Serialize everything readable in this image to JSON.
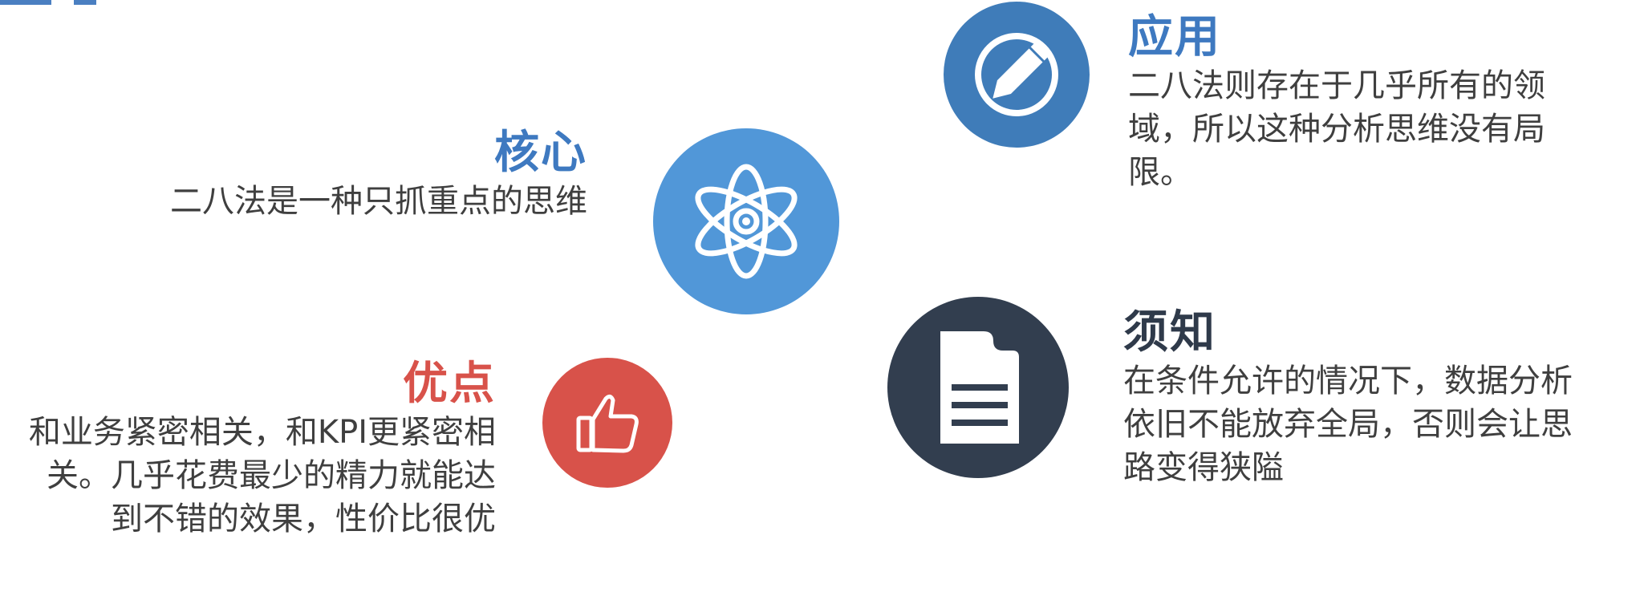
{
  "colors": {
    "core": "#5197d8",
    "application": "#3f7cb9",
    "advantage": "#d8524a",
    "notice": "#323e4f",
    "core_heading": "#3e79c0",
    "application_heading": "#3e79c0",
    "advantage_heading": "#d8524a",
    "notice_heading": "#2f3a4a"
  },
  "core": {
    "icon": "atom-icon",
    "title": "核心",
    "text": "二八法是一种只抓重点的思维"
  },
  "application": {
    "icon": "edit-pencil-icon",
    "title": "应用",
    "text": "二八法则存在于几乎所有的领域，所以这种分析思维没有局限。"
  },
  "advantage": {
    "icon": "thumbs-up-icon",
    "title": "优点",
    "text": "和业务紧密相关，和KPI更紧密相关。几乎花费最少的精力就能达到不错的效果，性价比很优"
  },
  "notice": {
    "icon": "document-icon",
    "title": "须知",
    "text": "在条件允许的情况下，数据分析依旧不能放弃全局，否则会让思路变得狭隘"
  }
}
